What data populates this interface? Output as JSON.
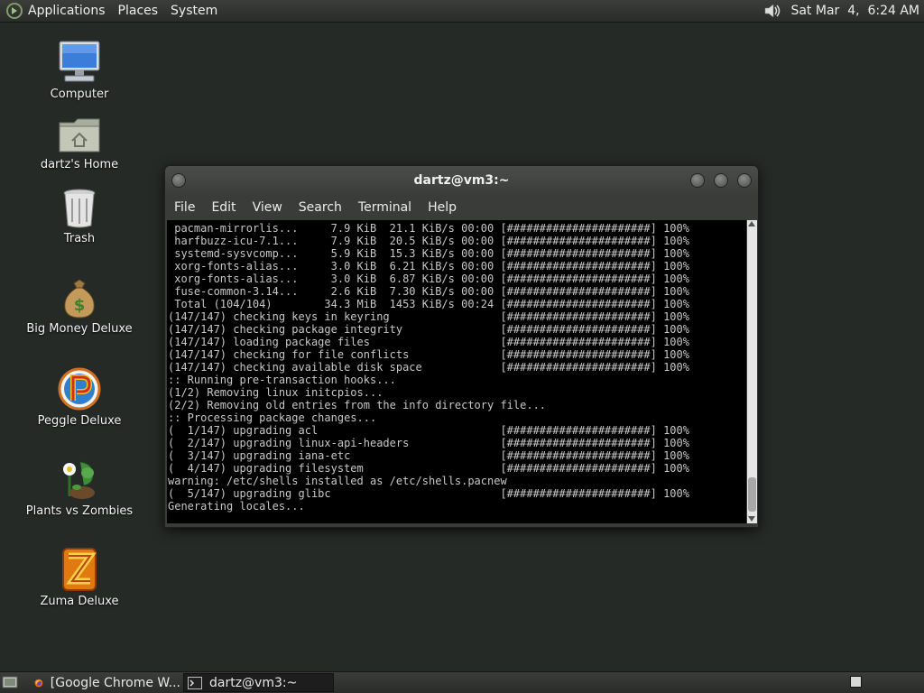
{
  "top_panel": {
    "menus": [
      "Applications",
      "Places",
      "System"
    ],
    "clock": "Sat Mar  4,  6:24 AM"
  },
  "desktop_icons": [
    {
      "label": "Computer",
      "icon": "computer-icon"
    },
    {
      "label": "dartz's Home",
      "icon": "home-folder-icon"
    },
    {
      "label": "Trash",
      "icon": "trash-icon"
    },
    {
      "label": "Big Money Deluxe",
      "icon": "money-bag-icon"
    },
    {
      "label": "Peggle Deluxe",
      "icon": "peggle-icon"
    },
    {
      "label": "Plants vs Zombies",
      "icon": "plants-vs-zombies-icon"
    },
    {
      "label": "Zuma Deluxe",
      "icon": "zuma-icon"
    }
  ],
  "window": {
    "title": "dartz@vm3:~",
    "menu": [
      "File",
      "Edit",
      "View",
      "Search",
      "Terminal",
      "Help"
    ]
  },
  "terminal": {
    "lines": [
      " pacman-mirrorlis...     7.9 KiB  21.1 KiB/s 00:00 [######################] 100%",
      " harfbuzz-icu-7.1...     7.9 KiB  20.5 KiB/s 00:00 [######################] 100%",
      " systemd-sysvcomp...     5.9 KiB  15.3 KiB/s 00:00 [######################] 100%",
      " xorg-fonts-alias...     3.0 KiB  6.21 KiB/s 00:00 [######################] 100%",
      " xorg-fonts-alias...     3.0 KiB  6.87 KiB/s 00:00 [######################] 100%",
      " fuse-common-3.14...     2.6 KiB  7.30 KiB/s 00:00 [######################] 100%",
      " Total (104/104)        34.3 MiB  1453 KiB/s 00:24 [######################] 100%",
      "(147/147) checking keys in keyring                 [######################] 100%",
      "(147/147) checking package integrity               [######################] 100%",
      "(147/147) loading package files                    [######################] 100%",
      "(147/147) checking for file conflicts              [######################] 100%",
      "(147/147) checking available disk space            [######################] 100%",
      ":: Running pre-transaction hooks...",
      "(1/2) Removing linux initcpios...",
      "(2/2) Removing old entries from the info directory file...",
      ":: Processing package changes...",
      "(  1/147) upgrading acl                            [######################] 100%",
      "(  2/147) upgrading linux-api-headers              [######################] 100%",
      "(  3/147) upgrading iana-etc                       [######################] 100%",
      "(  4/147) upgrading filesystem                     [######################] 100%",
      "warning: /etc/shells installed as /etc/shells.pacnew",
      "(  5/147) upgrading glibc                          [######################] 100%",
      "Generating locales..."
    ]
  },
  "taskbar": {
    "tasks": [
      {
        "label": "[Google Chrome W...",
        "icon": "firefox-icon"
      },
      {
        "label": "dartz@vm3:~",
        "icon": "terminal-icon"
      }
    ]
  }
}
